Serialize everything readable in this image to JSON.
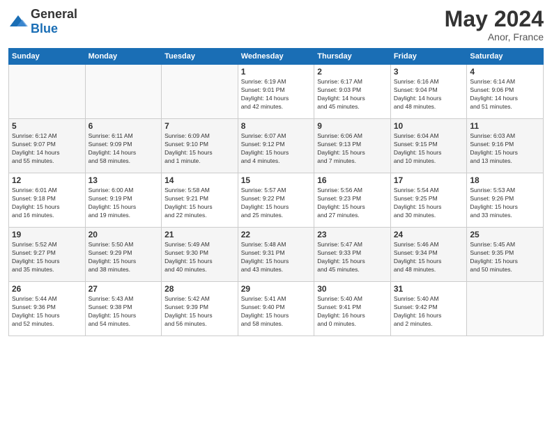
{
  "header": {
    "logo_general": "General",
    "logo_blue": "Blue",
    "month_year": "May 2024",
    "location": "Anor, France"
  },
  "days_of_week": [
    "Sunday",
    "Monday",
    "Tuesday",
    "Wednesday",
    "Thursday",
    "Friday",
    "Saturday"
  ],
  "weeks": [
    [
      {
        "day": "",
        "info": ""
      },
      {
        "day": "",
        "info": ""
      },
      {
        "day": "",
        "info": ""
      },
      {
        "day": "1",
        "info": "Sunrise: 6:19 AM\nSunset: 9:01 PM\nDaylight: 14 hours\nand 42 minutes."
      },
      {
        "day": "2",
        "info": "Sunrise: 6:17 AM\nSunset: 9:03 PM\nDaylight: 14 hours\nand 45 minutes."
      },
      {
        "day": "3",
        "info": "Sunrise: 6:16 AM\nSunset: 9:04 PM\nDaylight: 14 hours\nand 48 minutes."
      },
      {
        "day": "4",
        "info": "Sunrise: 6:14 AM\nSunset: 9:06 PM\nDaylight: 14 hours\nand 51 minutes."
      }
    ],
    [
      {
        "day": "5",
        "info": "Sunrise: 6:12 AM\nSunset: 9:07 PM\nDaylight: 14 hours\nand 55 minutes."
      },
      {
        "day": "6",
        "info": "Sunrise: 6:11 AM\nSunset: 9:09 PM\nDaylight: 14 hours\nand 58 minutes."
      },
      {
        "day": "7",
        "info": "Sunrise: 6:09 AM\nSunset: 9:10 PM\nDaylight: 15 hours\nand 1 minute."
      },
      {
        "day": "8",
        "info": "Sunrise: 6:07 AM\nSunset: 9:12 PM\nDaylight: 15 hours\nand 4 minutes."
      },
      {
        "day": "9",
        "info": "Sunrise: 6:06 AM\nSunset: 9:13 PM\nDaylight: 15 hours\nand 7 minutes."
      },
      {
        "day": "10",
        "info": "Sunrise: 6:04 AM\nSunset: 9:15 PM\nDaylight: 15 hours\nand 10 minutes."
      },
      {
        "day": "11",
        "info": "Sunrise: 6:03 AM\nSunset: 9:16 PM\nDaylight: 15 hours\nand 13 minutes."
      }
    ],
    [
      {
        "day": "12",
        "info": "Sunrise: 6:01 AM\nSunset: 9:18 PM\nDaylight: 15 hours\nand 16 minutes."
      },
      {
        "day": "13",
        "info": "Sunrise: 6:00 AM\nSunset: 9:19 PM\nDaylight: 15 hours\nand 19 minutes."
      },
      {
        "day": "14",
        "info": "Sunrise: 5:58 AM\nSunset: 9:21 PM\nDaylight: 15 hours\nand 22 minutes."
      },
      {
        "day": "15",
        "info": "Sunrise: 5:57 AM\nSunset: 9:22 PM\nDaylight: 15 hours\nand 25 minutes."
      },
      {
        "day": "16",
        "info": "Sunrise: 5:56 AM\nSunset: 9:23 PM\nDaylight: 15 hours\nand 27 minutes."
      },
      {
        "day": "17",
        "info": "Sunrise: 5:54 AM\nSunset: 9:25 PM\nDaylight: 15 hours\nand 30 minutes."
      },
      {
        "day": "18",
        "info": "Sunrise: 5:53 AM\nSunset: 9:26 PM\nDaylight: 15 hours\nand 33 minutes."
      }
    ],
    [
      {
        "day": "19",
        "info": "Sunrise: 5:52 AM\nSunset: 9:27 PM\nDaylight: 15 hours\nand 35 minutes."
      },
      {
        "day": "20",
        "info": "Sunrise: 5:50 AM\nSunset: 9:29 PM\nDaylight: 15 hours\nand 38 minutes."
      },
      {
        "day": "21",
        "info": "Sunrise: 5:49 AM\nSunset: 9:30 PM\nDaylight: 15 hours\nand 40 minutes."
      },
      {
        "day": "22",
        "info": "Sunrise: 5:48 AM\nSunset: 9:31 PM\nDaylight: 15 hours\nand 43 minutes."
      },
      {
        "day": "23",
        "info": "Sunrise: 5:47 AM\nSunset: 9:33 PM\nDaylight: 15 hours\nand 45 minutes."
      },
      {
        "day": "24",
        "info": "Sunrise: 5:46 AM\nSunset: 9:34 PM\nDaylight: 15 hours\nand 48 minutes."
      },
      {
        "day": "25",
        "info": "Sunrise: 5:45 AM\nSunset: 9:35 PM\nDaylight: 15 hours\nand 50 minutes."
      }
    ],
    [
      {
        "day": "26",
        "info": "Sunrise: 5:44 AM\nSunset: 9:36 PM\nDaylight: 15 hours\nand 52 minutes."
      },
      {
        "day": "27",
        "info": "Sunrise: 5:43 AM\nSunset: 9:38 PM\nDaylight: 15 hours\nand 54 minutes."
      },
      {
        "day": "28",
        "info": "Sunrise: 5:42 AM\nSunset: 9:39 PM\nDaylight: 15 hours\nand 56 minutes."
      },
      {
        "day": "29",
        "info": "Sunrise: 5:41 AM\nSunset: 9:40 PM\nDaylight: 15 hours\nand 58 minutes."
      },
      {
        "day": "30",
        "info": "Sunrise: 5:40 AM\nSunset: 9:41 PM\nDaylight: 16 hours\nand 0 minutes."
      },
      {
        "day": "31",
        "info": "Sunrise: 5:40 AM\nSunset: 9:42 PM\nDaylight: 16 hours\nand 2 minutes."
      },
      {
        "day": "",
        "info": ""
      }
    ]
  ]
}
